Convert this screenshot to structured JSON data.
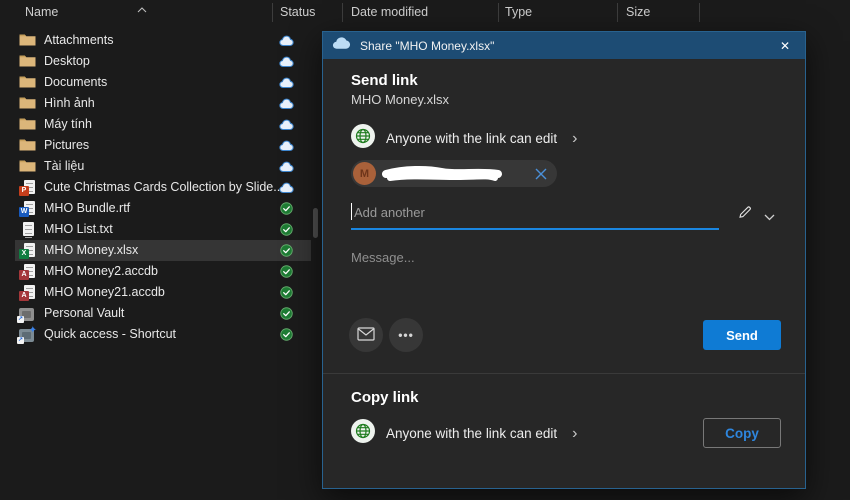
{
  "explorer": {
    "columns": [
      "Name",
      "Status",
      "Date modified",
      "Type",
      "Size"
    ],
    "sort": {
      "column": "Name",
      "direction": "ascending"
    },
    "rows": [
      {
        "name": "Attachments",
        "icon": "folder",
        "status": "cloud"
      },
      {
        "name": "Desktop",
        "icon": "folder",
        "status": "cloud"
      },
      {
        "name": "Documents",
        "icon": "folder",
        "status": "cloud"
      },
      {
        "name": "Hình ảnh",
        "icon": "folder",
        "status": "cloud"
      },
      {
        "name": "Máy tính",
        "icon": "folder",
        "status": "cloud"
      },
      {
        "name": "Pictures",
        "icon": "folder",
        "status": "cloud"
      },
      {
        "name": "Tài liệu",
        "icon": "folder",
        "status": "cloud"
      },
      {
        "name": "Cute Christmas Cards Collection by Slide...",
        "icon": "powerpoint",
        "status": "cloud"
      },
      {
        "name": "MHO Bundle.rtf",
        "icon": "word",
        "status": "synced"
      },
      {
        "name": "MHO List.txt",
        "icon": "text",
        "status": "synced"
      },
      {
        "name": "MHO Money.xlsx",
        "icon": "excel",
        "status": "synced",
        "selected": true
      },
      {
        "name": "MHO Money2.accdb",
        "icon": "access",
        "status": "synced"
      },
      {
        "name": "MHO Money21.accdb",
        "icon": "access",
        "status": "synced"
      },
      {
        "name": "Personal Vault",
        "icon": "vault",
        "status": "synced"
      },
      {
        "name": "Quick access - Shortcut",
        "icon": "shortcut",
        "status": "synced"
      }
    ]
  },
  "dialog": {
    "title": "Share \"MHO Money.xlsx\"",
    "send_section": {
      "heading": "Send link",
      "filename": "MHO Money.xlsx",
      "permission_label": "Anyone with the link can edit",
      "recipient": {
        "avatar_initial": "M",
        "name_redacted": true
      },
      "add_recipient_placeholder": "Add another",
      "message_placeholder": "Message...",
      "send_button_label": "Send"
    },
    "copy_section": {
      "heading": "Copy link",
      "permission_label": "Anyone with the link can edit",
      "copy_button_label": "Copy"
    }
  },
  "icons": {
    "chevron_right_glyph": "›",
    "ellipsis_glyph": "•••",
    "close_glyph": "✕"
  },
  "colors": {
    "dialog_titlebar": "#1d4c74",
    "accent_blue": "#0f7bd4",
    "copy_text_blue": "#2e86de",
    "folder_yellow": "#dcb67a",
    "cloud_status_blue": "#3f87cf",
    "synced_status_green": "#1e7c34",
    "avatar_brown": "#a9613a"
  }
}
